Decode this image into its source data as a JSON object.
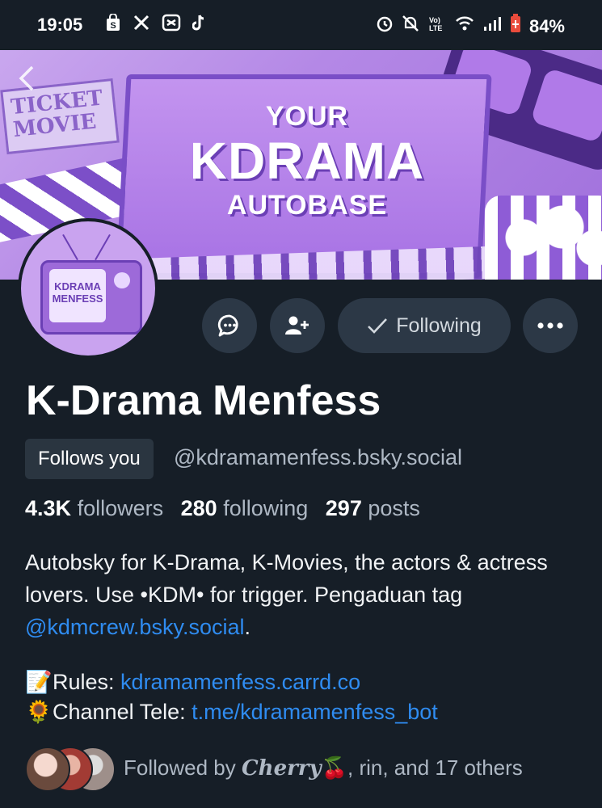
{
  "status_bar": {
    "time": "19:05",
    "left_icons": [
      "shopping-bag-icon",
      "x-app-icon",
      "capcut-icon",
      "tiktok-icon"
    ],
    "right_icons": [
      "alarm-icon",
      "mute-icon",
      "volte-icon",
      "wifi-icon",
      "signal-icon",
      "battery-icon"
    ],
    "volte_label": "Vo)\nLTE",
    "battery": "84%"
  },
  "banner": {
    "ticket_text": "TICKET\nMOVIE",
    "title_line1": "YOUR",
    "title_line2": "KDRAMA",
    "title_line3": "AUTOBASE"
  },
  "avatar": {
    "logo_text": "KDRAMA\nMENFESS"
  },
  "actions": {
    "following_label": "Following"
  },
  "profile": {
    "display_name": "K-Drama Menfess",
    "follows_you": "Follows you",
    "handle": "@kdramamenfess.bsky.social",
    "followers_count": "4.3K",
    "followers_label": "followers",
    "following_count": "280",
    "following_label": "following",
    "posts_count": "297",
    "posts_label": "posts",
    "bio_text": "Autobsky for K-Drama, K-Movies, the actors & actress lovers. Use •KDM• for trigger. Pengaduan tag ",
    "bio_mention": "@kdmcrew.bsky.social",
    "bio_end": ".",
    "rules_emoji": "📝",
    "rules_label": "Rules: ",
    "rules_link": "kdramamenfess.carrd.co",
    "tele_emoji": "🌻",
    "tele_label": "Channel Tele: ",
    "tele_link": "t.me/kdramamenfess_bot"
  },
  "followed_by": {
    "prefix": "Followed by ",
    "name1": "Cherry",
    "name1_emoji": "🍒",
    "rest": ", rin, and 17 others"
  }
}
